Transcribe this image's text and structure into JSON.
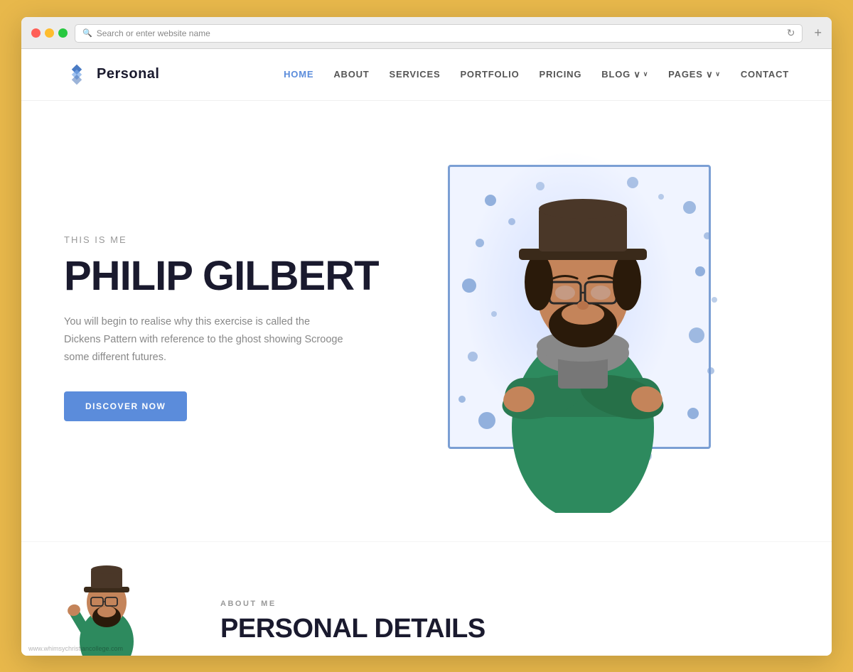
{
  "browser": {
    "address_placeholder": "Search or enter website name",
    "address_text": "Search or enter website name",
    "new_tab_label": "+"
  },
  "navbar": {
    "logo_text": "Personal",
    "nav_items": [
      {
        "label": "HOME",
        "active": true,
        "has_dropdown": false
      },
      {
        "label": "ABOUT",
        "active": false,
        "has_dropdown": false
      },
      {
        "label": "SERVICES",
        "active": false,
        "has_dropdown": false
      },
      {
        "label": "PORTFOLIO",
        "active": false,
        "has_dropdown": false
      },
      {
        "label": "PRICING",
        "active": false,
        "has_dropdown": false
      },
      {
        "label": "BLOG",
        "active": false,
        "has_dropdown": true
      },
      {
        "label": "PAGES",
        "active": false,
        "has_dropdown": true
      },
      {
        "label": "CONTACT",
        "active": false,
        "has_dropdown": false
      }
    ]
  },
  "hero": {
    "subtitle": "THIS IS ME",
    "name": "PHILIP GILBERT",
    "description": "You will begin to realise why this exercise is called the Dickens Pattern with reference to the ghost showing Scrooge some different futures.",
    "cta_button": "DISCOVER NOW"
  },
  "about_section": {
    "label": "ABOUT ME",
    "heading": "PERSONAL DETAILS"
  },
  "watermark": "www.whimsychristiancollege.com",
  "colors": {
    "accent_blue": "#5b8cdb",
    "frame_border": "#7b9fd4",
    "frame_bg": "#f0f4ff",
    "dot_color": "#7b9fd4",
    "body_bg": "#fff",
    "nav_active": "#5b8cdb",
    "hero_name_color": "#1a1a2e",
    "hero_subtitle_color": "#999",
    "hero_desc_color": "#888",
    "logo_color": "#1a1a2e",
    "browser_bg": "#e8b84b"
  }
}
